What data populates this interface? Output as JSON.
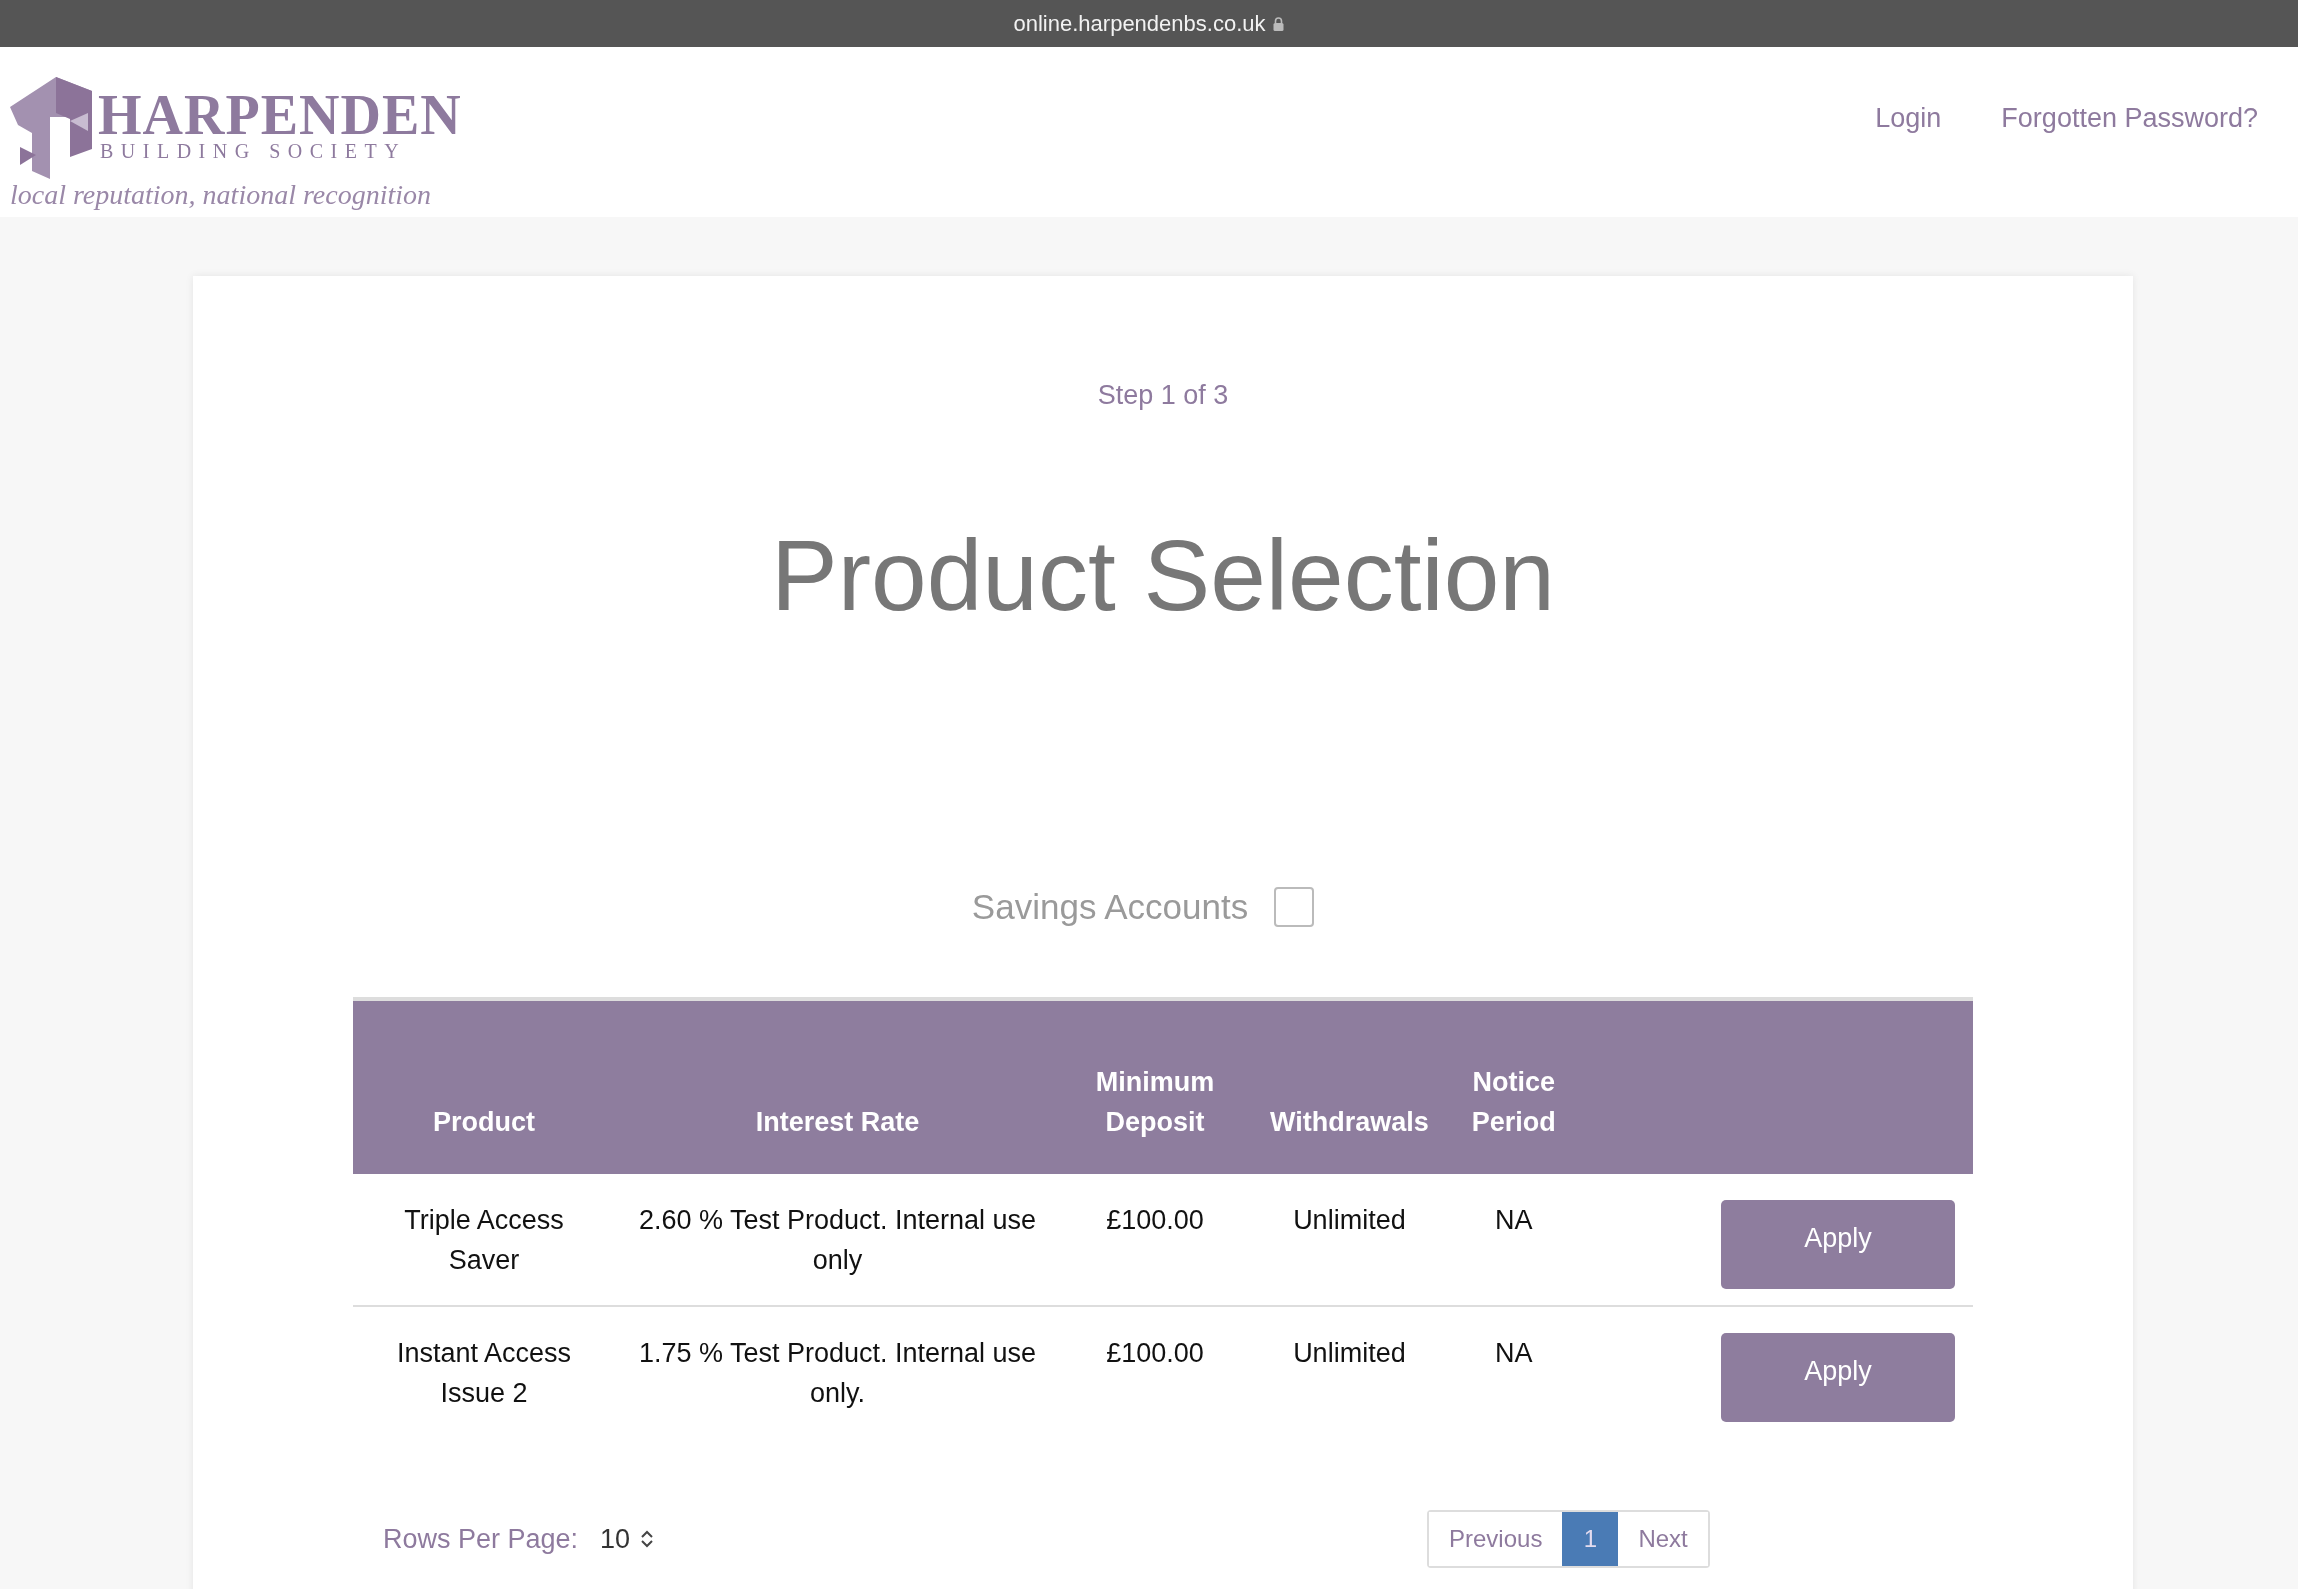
{
  "browser_bar": {
    "url": "online.harpendenbs.co.uk"
  },
  "logo": {
    "name": "HARPENDEN",
    "subtitle": "BUILDING SOCIETY",
    "tagline": "local reputation, national recognition"
  },
  "nav": [
    "Login",
    "Forgotten Password?"
  ],
  "step": "Step 1 of 3",
  "title": "Product Selection",
  "filter": {
    "label": "Savings Accounts",
    "checked": false
  },
  "table": {
    "columns": [
      "Product",
      "Interest Rate",
      "Minimum Deposit",
      "Withdrawals",
      "Notice Period"
    ],
    "rows": [
      {
        "product": "Triple Access Saver",
        "interest_rate": "2.60 % Test Product. Internal use only",
        "minimum_deposit": "£100.00",
        "withdrawals": "Unlimited",
        "notice_period": "NA",
        "action": "Apply"
      },
      {
        "product": "Instant Access Issue 2",
        "interest_rate": "1.75 % Test Product. Internal use only.",
        "minimum_deposit": "£100.00",
        "withdrawals": "Unlimited",
        "notice_period": "NA",
        "action": "Apply"
      }
    ]
  },
  "pagination": {
    "rows_label": "Rows Per Page:",
    "rows_value": "10",
    "previous": "Previous",
    "pages": [
      {
        "label": "1",
        "selected": true
      }
    ],
    "next": "Next"
  }
}
